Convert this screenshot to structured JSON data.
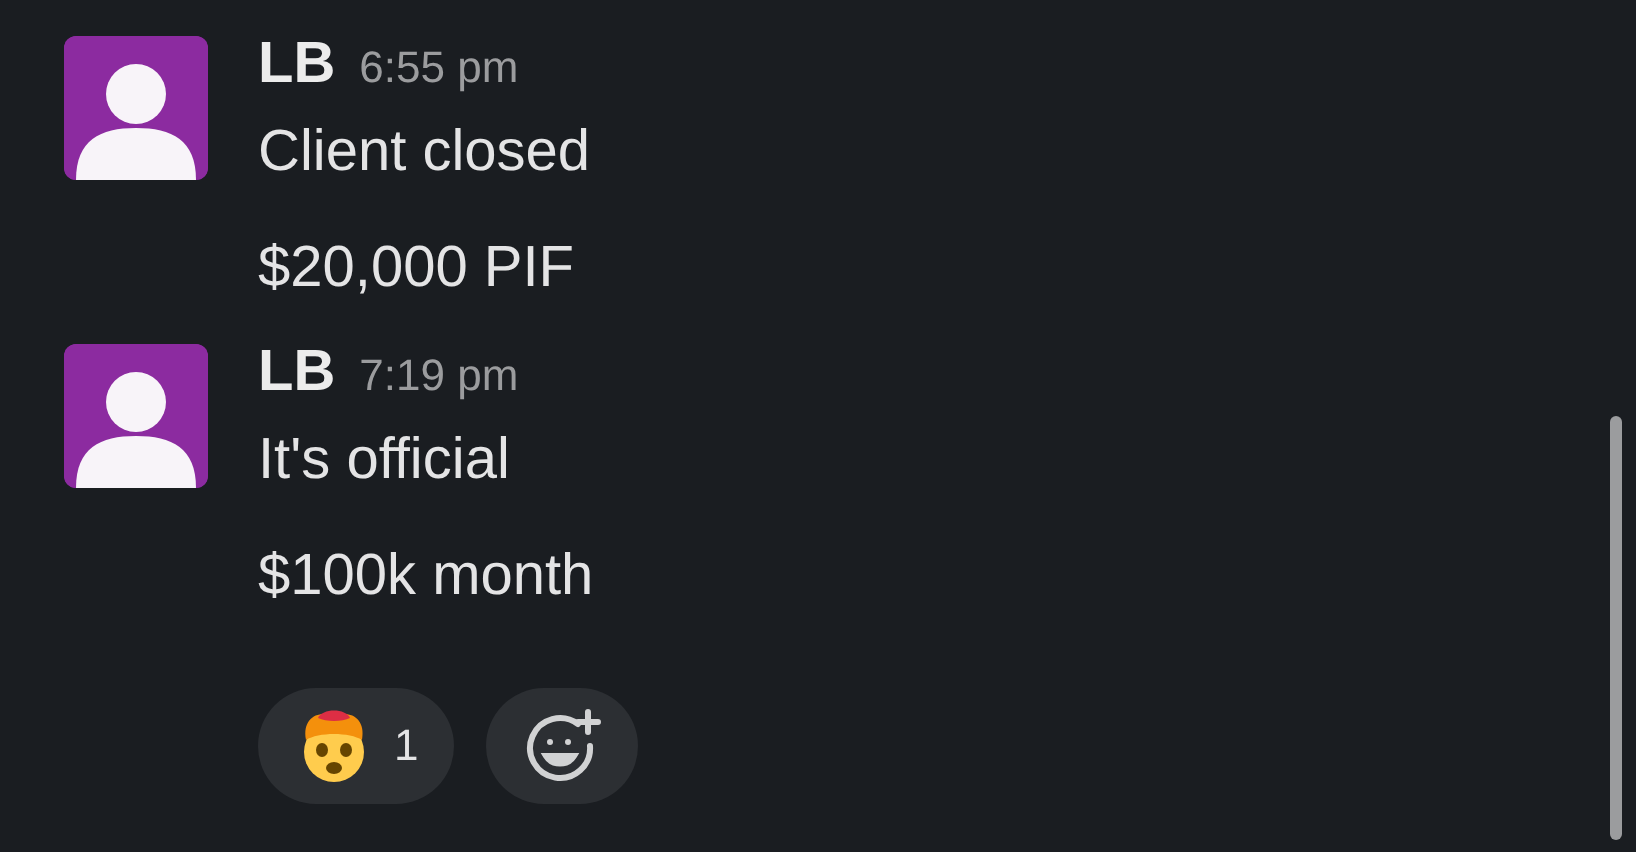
{
  "messages": [
    {
      "author": "LB",
      "time": "6:55 pm",
      "lines": [
        "Client closed",
        "$20,000 PIF"
      ]
    },
    {
      "author": "LB",
      "time": "7:19 pm",
      "lines": [
        "It's official",
        "$100k month"
      ],
      "reactions": [
        {
          "count": "1"
        }
      ]
    }
  ]
}
